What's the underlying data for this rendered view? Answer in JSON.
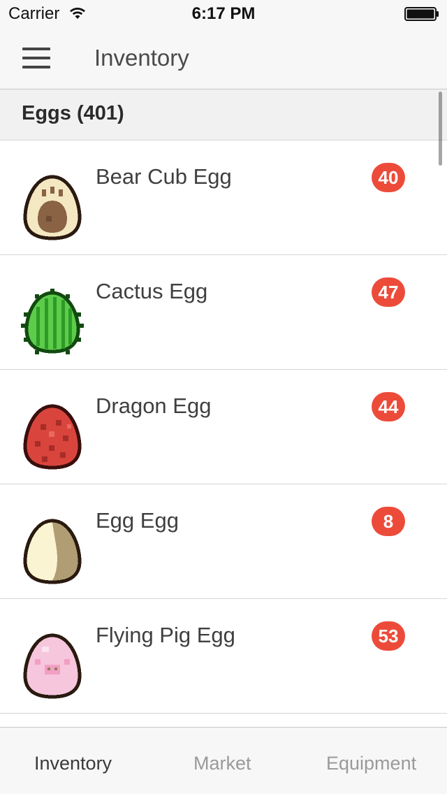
{
  "status_bar": {
    "carrier": "Carrier",
    "time": "6:17 PM",
    "icons": [
      "wifi-icon",
      "battery-icon"
    ]
  },
  "nav": {
    "title": "Inventory",
    "menu_icon": "hamburger-menu-icon"
  },
  "section": {
    "title": "Eggs (401)"
  },
  "items": [
    {
      "label": "Bear Cub Egg",
      "count": "40",
      "icon": "bear-cub-egg-icon"
    },
    {
      "label": "Cactus Egg",
      "count": "47",
      "icon": "cactus-egg-icon"
    },
    {
      "label": "Dragon Egg",
      "count": "44",
      "icon": "dragon-egg-icon"
    },
    {
      "label": "Egg Egg",
      "count": "8",
      "icon": "egg-egg-icon"
    },
    {
      "label": "Flying Pig Egg",
      "count": "53",
      "icon": "flying-pig-egg-icon"
    }
  ],
  "tabs": [
    {
      "label": "Inventory",
      "active": true
    },
    {
      "label": "Market",
      "active": false
    },
    {
      "label": "Equipment",
      "active": false
    }
  ],
  "colors": {
    "badge": "#ed4b3a",
    "bar_background": "#f7f7f7",
    "section_background": "#f1f1f1",
    "tab_inactive": "#9a9a9a",
    "tab_active": "#3a3a3a"
  }
}
